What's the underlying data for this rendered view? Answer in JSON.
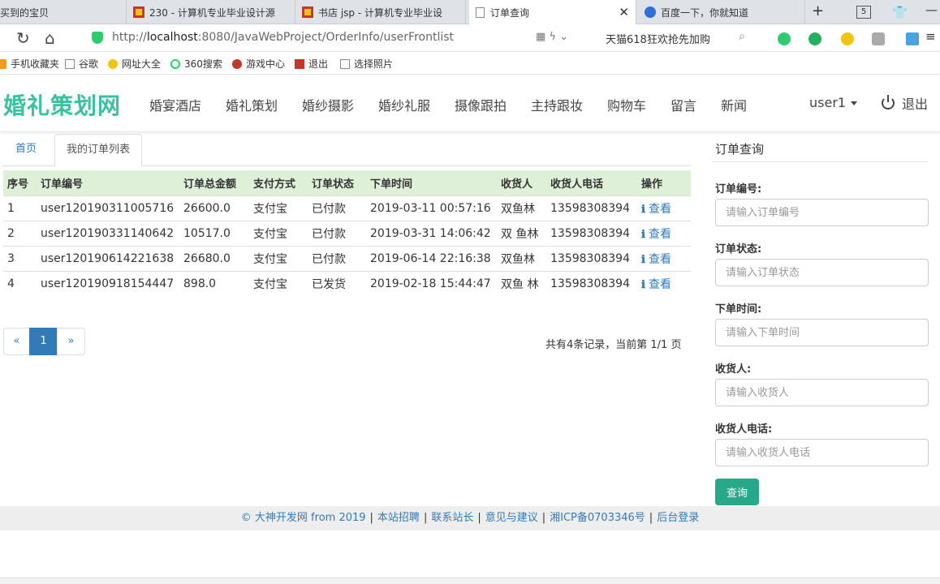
{
  "browser": {
    "tabs": [
      {
        "label": "买到的宝贝"
      },
      {
        "label": "230 - 计算机专业毕业设计源"
      },
      {
        "label": "书店 jsp - 计算机专业毕业设"
      },
      {
        "label": "订单查询"
      },
      {
        "label": "百度一下，你就知道"
      }
    ],
    "tab_count": "5",
    "url_prefix": "http://",
    "url_host": "localhost",
    "url_rest": ":8080/JavaWebProject/OrderInfo/userFrontlist",
    "promo_text": "天猫618狂欢抢先加购",
    "bookmarks": [
      "手机收藏夹",
      "谷歌",
      "网址大全",
      "360搜索",
      "游戏中心",
      "退出",
      "选择照片"
    ]
  },
  "site": {
    "brand": "婚礼策划网",
    "nav": [
      "婚宴酒店",
      "婚礼策划",
      "婚纱摄影",
      "婚纱礼服",
      "摄像跟拍",
      "主持跟妆",
      "购物车",
      "留言",
      "新闻"
    ],
    "user": "user1",
    "logout": "退出"
  },
  "content_tabs": [
    "首页",
    "我的订单列表"
  ],
  "table": {
    "headers": [
      "序号",
      "订单编号",
      "订单总金额",
      "支付方式",
      "订单状态",
      "下单时间",
      "收货人",
      "收货人电话",
      "操作"
    ],
    "rows": [
      [
        "1",
        "user120190311005716",
        "26600.0",
        "支付宝",
        "已付款",
        "2019-03-11 00:57:16",
        "双鱼林",
        "13598308394",
        "查看"
      ],
      [
        "2",
        "user120190331140642",
        "10517.0",
        "支付宝",
        "已付款",
        "2019-03-31 14:06:42",
        "双 鱼林",
        "13598308394",
        "查看"
      ],
      [
        "3",
        "user120190614221638",
        "26680.0",
        "支付宝",
        "已付款",
        "2019-06-14 22:16:38",
        "双鱼林",
        "13598308394",
        "查看"
      ],
      [
        "4",
        "user120190918154447",
        "898.0",
        "支付宝",
        "已发货",
        "2019-02-18 15:44:47",
        "双鱼 林",
        "13598308394",
        "查看"
      ]
    ]
  },
  "pagination": {
    "prev": "«",
    "current": "1",
    "next": "»",
    "summary": "共有4条记录，当前第 1/1 页"
  },
  "search": {
    "title": "订单查询",
    "fields": [
      {
        "label": "订单编号:",
        "placeholder": "请输入订单编号"
      },
      {
        "label": "订单状态:",
        "placeholder": "请输入订单状态"
      },
      {
        "label": "下单时间:",
        "placeholder": "请输入下单时间"
      },
      {
        "label": "收货人:",
        "placeholder": "请输入收货人"
      },
      {
        "label": "收货人电话:",
        "placeholder": "请输入收货人电话"
      }
    ],
    "button": "查询"
  },
  "footer": [
    "© 大神开发网 from 2019",
    "本站招聘",
    "联系站长",
    "意见与建议",
    "湘ICP备0703346号",
    "后台登录"
  ],
  "colors": {
    "brand": "#3cc0a0",
    "link": "#337ab7",
    "header_row": "#dff0d8",
    "query_button": "#26a889"
  }
}
